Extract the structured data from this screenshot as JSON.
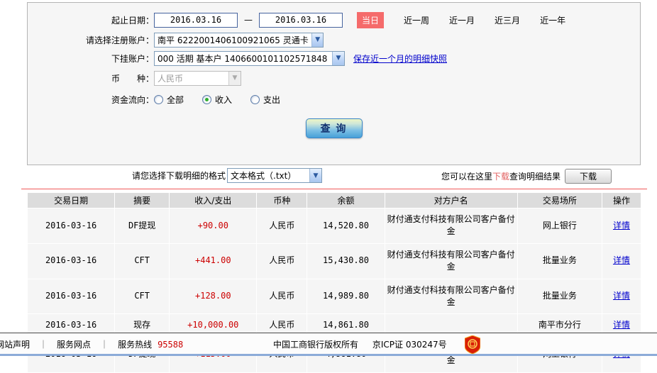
{
  "form": {
    "date_range_label": "起止日期：",
    "date_from": "2016.03.16",
    "date_separator": "—",
    "date_to": "2016.03.16",
    "quick_ranges": {
      "today": "当日",
      "week": "近一周",
      "month": "近一月",
      "quarter": "近三月",
      "year": "近一年"
    },
    "register_account_label": "请选择注册账户：",
    "register_account_value": "南平 6222001406100921065 灵通卡",
    "sub_account_label": "下挂账户：",
    "sub_account_value": "000 活期 基本户 1406600101102571848",
    "snapshot_link": "保存近一个月的明细快照",
    "currency_label": "币　　种：",
    "currency_value": "人民币",
    "flow_label": "资金流向：",
    "flow_options": [
      "全部",
      "收入",
      "支出"
    ],
    "flow_selected": "收入",
    "query_button": "查 询",
    "dropdown_arrow": "▼"
  },
  "download": {
    "format_label": "请您选择下载明细的格式",
    "format_value": "文本格式（.txt）",
    "hint_prefix": "您可以在这里",
    "hint_download_link": "下载",
    "hint_suffix": "查询明细结果",
    "download_button": "下载"
  },
  "table": {
    "headers": [
      "交易日期",
      "摘要",
      "收入/支出",
      "币种",
      "余额",
      "对方户名",
      "交易场所",
      "操作"
    ],
    "rows": [
      {
        "date": "2016-03-16",
        "summary": "DF提现",
        "amount": "+90.00",
        "currency": "人民币",
        "balance": "14,520.80",
        "counterparty": "财付通支付科技有限公司客户备付金",
        "venue": "网上银行",
        "action": "详情"
      },
      {
        "date": "2016-03-16",
        "summary": "CFT",
        "amount": "+441.00",
        "currency": "人民币",
        "balance": "15,430.80",
        "counterparty": "财付通支付科技有限公司客户备付金",
        "venue": "批量业务",
        "action": "详情"
      },
      {
        "date": "2016-03-16",
        "summary": "CFT",
        "amount": "+128.00",
        "currency": "人民币",
        "balance": "14,989.80",
        "counterparty": "财付通支付科技有限公司客户备付金",
        "venue": "批量业务",
        "action": "详情"
      },
      {
        "date": "2016-03-16",
        "summary": "现存",
        "amount": "+10,000.00",
        "currency": "人民币",
        "balance": "14,861.80",
        "counterparty": "",
        "venue": "南平市分行",
        "action": "详情"
      },
      {
        "date": "2016-03-16",
        "summary": "DF提现",
        "amount": "+115.00",
        "currency": "人民币",
        "balance": "4,861.80",
        "counterparty": "财付通支付科技有限公司客户备付金",
        "venue": "网上银行",
        "action": "详情"
      }
    ]
  },
  "footer": {
    "link_statement": "网站声明",
    "separator": "｜",
    "link_branches": "服务网点",
    "hotline_label": "服务热线",
    "hotline_number": "95588",
    "copyright": "中国工商银行版权所有",
    "icp": "京ICP证 030247号"
  },
  "colors": {
    "today_highlight": "#f56b6b",
    "amount_red": "#cc0000",
    "link_blue": "#0000cc",
    "divider_red": "#f05a5a"
  }
}
